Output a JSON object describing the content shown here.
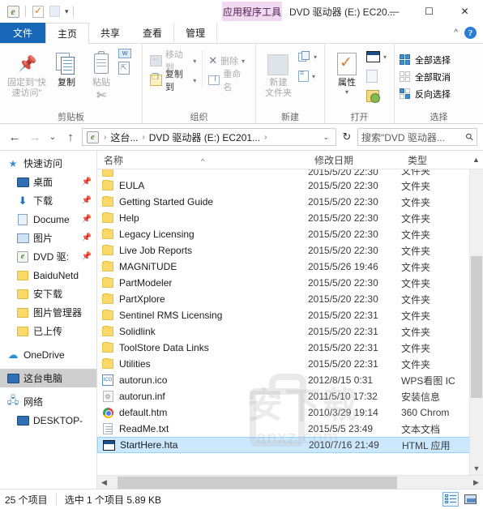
{
  "titlebar": {
    "quick_access": [
      {
        "name": "ie-icon",
        "glyph": "e"
      },
      {
        "name": "properties-icon",
        "glyph": ""
      },
      {
        "name": "new-folder-icon",
        "glyph": ""
      }
    ],
    "contextual_tab_label": "应用程序工具",
    "window_title": "DVD 驱动器 (E:) EC20...",
    "minimize": "—",
    "maximize": "☐",
    "close": "✕"
  },
  "ribbon": {
    "tabs": [
      {
        "label": "文件",
        "state": "file"
      },
      {
        "label": "主页",
        "state": "active"
      },
      {
        "label": "共享",
        "state": "normal"
      },
      {
        "label": "查看",
        "state": "normal"
      },
      {
        "label": "管理",
        "state": "contextual"
      }
    ],
    "collapse_label": "^",
    "help_label": "?",
    "groups": [
      {
        "label": "剪贴板",
        "pin_label": "固定到\"快速访问\"",
        "copy_label": "复制",
        "paste_label": "粘贴",
        "word_icon_label": "W"
      },
      {
        "label": "组织",
        "move_to": "移动到",
        "copy_to": "复制到",
        "delete": "删除",
        "rename": "重命名"
      },
      {
        "label": "新建",
        "new_folder_line1": "新建",
        "new_folder_line2": "文件夹"
      },
      {
        "label": "打开",
        "properties": "属性"
      },
      {
        "label": "选择",
        "select_all": "全部选择",
        "select_none": "全部取消",
        "invert_selection": "反向选择"
      }
    ]
  },
  "addressbar": {
    "back": "←",
    "forward": "→",
    "recent": "⌄",
    "up": "↑",
    "crumbs": [
      "这台...",
      "DVD 驱动器 (E:) EC201..."
    ],
    "dropdown": "⌄",
    "refresh": "↻",
    "search_placeholder": "搜索\"DVD 驱动器...",
    "search_value": ""
  },
  "nav_pane": {
    "items": [
      {
        "label": "快速访问",
        "icon": "star-icon",
        "level": 0,
        "pinned": false,
        "selected": false
      },
      {
        "label": "桌面",
        "icon": "desktop-icon",
        "level": 1,
        "pinned": true,
        "selected": false
      },
      {
        "label": "下载",
        "icon": "download-icon",
        "level": 1,
        "pinned": true,
        "selected": false
      },
      {
        "label": "Docume",
        "icon": "documents-icon",
        "level": 1,
        "pinned": true,
        "selected": false
      },
      {
        "label": "图片",
        "icon": "pictures-icon",
        "level": 1,
        "pinned": true,
        "selected": false
      },
      {
        "label": "DVD 驱:",
        "icon": "ie-icon",
        "level": 1,
        "pinned": true,
        "selected": false
      },
      {
        "label": "BaiduNetd",
        "icon": "folder-icon",
        "level": 1,
        "pinned": false,
        "selected": false
      },
      {
        "label": "安下载",
        "icon": "folder-icon",
        "level": 1,
        "pinned": false,
        "selected": false
      },
      {
        "label": "图片管理器",
        "icon": "folder-icon",
        "level": 1,
        "pinned": false,
        "selected": false
      },
      {
        "label": "已上传",
        "icon": "folder-icon",
        "level": 1,
        "pinned": false,
        "selected": false
      },
      {
        "label": "OneDrive",
        "icon": "cloud-icon",
        "level": 0,
        "pinned": false,
        "selected": false
      },
      {
        "label": "这台电脑",
        "icon": "desktop-icon",
        "level": 0,
        "pinned": false,
        "selected": true
      },
      {
        "label": "网络",
        "icon": "network-icon",
        "level": 0,
        "pinned": false,
        "selected": false
      },
      {
        "label": "DESKTOP-",
        "icon": "desktop-icon",
        "level": 1,
        "pinned": false,
        "selected": false
      }
    ]
  },
  "file_list": {
    "columns": [
      {
        "label": "名称",
        "sorted": true,
        "sort_dir": "asc"
      },
      {
        "label": "修改日期",
        "sorted": false
      },
      {
        "label": "类型",
        "sorted": false
      }
    ],
    "rows": [
      {
        "name": "",
        "date": "2015/5/20 22:30",
        "type": "文件夹",
        "icon": "folder-icon",
        "partial": true,
        "selected": false
      },
      {
        "name": "EULA",
        "date": "2015/5/20 22:30",
        "type": "文件夹",
        "icon": "folder-icon",
        "selected": false
      },
      {
        "name": "Getting Started Guide",
        "date": "2015/5/20 22:30",
        "type": "文件夹",
        "icon": "folder-icon",
        "selected": false
      },
      {
        "name": "Help",
        "date": "2015/5/20 22:30",
        "type": "文件夹",
        "icon": "folder-icon",
        "selected": false
      },
      {
        "name": "Legacy Licensing",
        "date": "2015/5/20 22:30",
        "type": "文件夹",
        "icon": "folder-icon",
        "selected": false
      },
      {
        "name": "Live Job Reports",
        "date": "2015/5/20 22:30",
        "type": "文件夹",
        "icon": "folder-icon",
        "selected": false
      },
      {
        "name": "MAGNiTUDE",
        "date": "2015/5/26 19:46",
        "type": "文件夹",
        "icon": "folder-icon",
        "selected": false
      },
      {
        "name": "PartModeler",
        "date": "2015/5/20 22:30",
        "type": "文件夹",
        "icon": "folder-icon",
        "selected": false
      },
      {
        "name": "PartXplore",
        "date": "2015/5/20 22:30",
        "type": "文件夹",
        "icon": "folder-icon",
        "selected": false
      },
      {
        "name": "Sentinel RMS Licensing",
        "date": "2015/5/20 22:31",
        "type": "文件夹",
        "icon": "folder-icon",
        "selected": false
      },
      {
        "name": "Solidlink",
        "date": "2015/5/20 22:31",
        "type": "文件夹",
        "icon": "folder-icon",
        "selected": false
      },
      {
        "name": "ToolStore Data Links",
        "date": "2015/5/20 22:31",
        "type": "文件夹",
        "icon": "folder-icon",
        "selected": false
      },
      {
        "name": "Utilities",
        "date": "2015/5/20 22:31",
        "type": "文件夹",
        "icon": "folder-icon",
        "selected": false
      },
      {
        "name": "autorun.ico",
        "date": "2012/8/15 0:31",
        "type": "WPS看图 IC",
        "icon": "ico-file-icon",
        "selected": false
      },
      {
        "name": "autorun.inf",
        "date": "2011/5/10 17:32",
        "type": "安装信息",
        "icon": "inf-file-icon",
        "selected": false
      },
      {
        "name": "default.htm",
        "date": "2010/3/29 19:14",
        "type": "360 Chrom",
        "icon": "chrome-file-icon",
        "selected": false
      },
      {
        "name": "ReadMe.txt",
        "date": "2015/5/5 23:49",
        "type": "文本文档",
        "icon": "text-file-icon",
        "selected": false
      },
      {
        "name": "StartHere.hta",
        "date": "2010/7/16 21:49",
        "type": "HTML 应用",
        "icon": "hta-file-icon",
        "selected": true
      }
    ],
    "watermark_top": "安下载",
    "watermark_bottom": "anxz.com"
  },
  "statusbar": {
    "item_count": "25 个项目",
    "selection_info": "选中 1 个项目  5.89 KB",
    "view_details": "details-view",
    "view_thumbnails": "thumbnails-view"
  },
  "colors": {
    "accent": "#1667b8",
    "selection": "#cce8ff",
    "contextual": "#f2d9f2",
    "folder": "#fbd96b"
  }
}
